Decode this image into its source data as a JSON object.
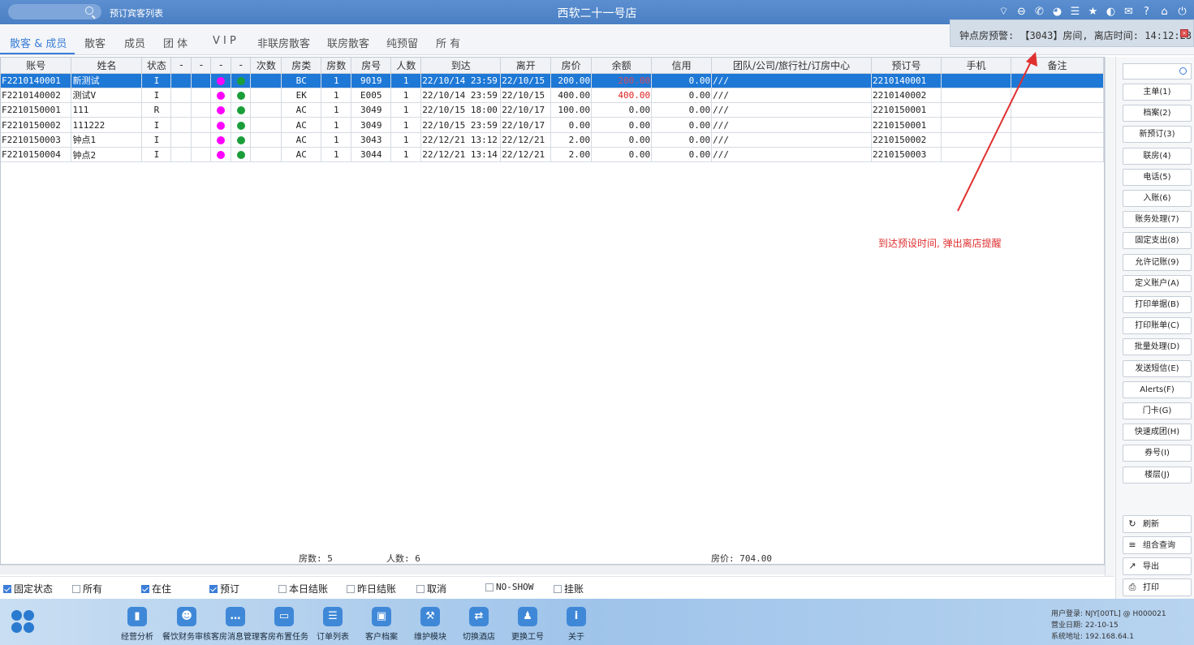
{
  "titlebar": {
    "booking_link": "预订宾客列表",
    "hotel_name": "西软二十一号店",
    "icons": [
      "wifi-icon",
      "minus-circle-icon",
      "phone-icon",
      "palette-icon",
      "menu-icon",
      "star-icon",
      "contrast-icon",
      "mail-icon",
      "help-icon",
      "home-icon",
      "power-icon"
    ]
  },
  "alert": {
    "text": "钟点房预警: 【3043】房间, 离店时间: 14:12:23"
  },
  "tabs": [
    {
      "label": "散客 & 成员",
      "active": true
    },
    {
      "label": "散客"
    },
    {
      "label": "成员"
    },
    {
      "label": "团 体"
    },
    {
      "label": "V I P"
    },
    {
      "label": "非联房散客"
    },
    {
      "label": "联房散客"
    },
    {
      "label": "纯预留"
    },
    {
      "label": "所 有"
    }
  ],
  "grid": {
    "columns": [
      "账号",
      "姓名",
      "状态",
      "-",
      "-",
      "-",
      "-",
      "次数",
      "房类",
      "房数",
      "房号",
      "人数",
      "到达",
      "离开",
      "房价",
      "余额",
      "信用",
      "团队/公司/旅行社/订房中心",
      "预订号",
      "手机",
      "备注"
    ],
    "rows": [
      {
        "account": "F2210140001",
        "name": "新测试",
        "status": "I",
        "c1": "",
        "c2": "",
        "dot1": "#ff00ff",
        "dot2": "#1a9e3a",
        "times": "",
        "room_type": "BC",
        "rooms": "1",
        "room_no": "9019",
        "persons": "1",
        "arrive": "22/10/14 23:59",
        "depart": "22/10/15",
        "rate": "200.00",
        "balance": "200.00",
        "balance_red": true,
        "credit": "0.00",
        "group": "///",
        "booking_no": "2210140001",
        "mobile": "",
        "remark": "",
        "selected": true
      },
      {
        "account": "F2210140002",
        "name": "测试V",
        "status": "I",
        "c1": "",
        "c2": "",
        "dot1": "#ff00ff",
        "dot2": "#1a9e3a",
        "times": "",
        "room_type": "EK",
        "rooms": "1",
        "room_no": "E005",
        "persons": "1",
        "arrive": "22/10/14 23:59",
        "depart": "22/10/15",
        "rate": "400.00",
        "balance": "400.00",
        "balance_red": true,
        "credit": "0.00",
        "group": "///",
        "booking_no": "2210140002",
        "mobile": "",
        "remark": ""
      },
      {
        "account": "F2210150001",
        "name": "111",
        "status": "R",
        "c1": "",
        "c2": "",
        "dot1": "#ff00ff",
        "dot2": "#1a9e3a",
        "times": "",
        "room_type": "AC",
        "rooms": "1",
        "room_no": "3049",
        "persons": "1",
        "arrive": "22/10/15 18:00",
        "depart": "22/10/17",
        "rate": "100.00",
        "balance": "0.00",
        "balance_red": false,
        "credit": "0.00",
        "group": "///",
        "booking_no": "2210150001",
        "mobile": "",
        "remark": ""
      },
      {
        "account": "F2210150002",
        "name": "111222",
        "status": "I",
        "c1": "",
        "c2": "",
        "dot1": "#ff00ff",
        "dot2": "#1a9e3a",
        "times": "",
        "room_type": "AC",
        "rooms": "1",
        "room_no": "3049",
        "persons": "1",
        "arrive": "22/10/15 23:59",
        "depart": "22/10/17",
        "rate": "0.00",
        "balance": "0.00",
        "balance_red": false,
        "credit": "0.00",
        "group": "///",
        "booking_no": "2210150001",
        "mobile": "",
        "remark": ""
      },
      {
        "account": "F2210150003",
        "name": "钟点1",
        "status": "I",
        "c1": "",
        "c2": "",
        "dot1": "#ff00ff",
        "dot2": "#1a9e3a",
        "times": "",
        "room_type": "AC",
        "rooms": "1",
        "room_no": "3043",
        "persons": "1",
        "arrive": "22/12/21 13:12",
        "depart": "22/12/21",
        "rate": "2.00",
        "balance": "0.00",
        "balance_red": false,
        "credit": "0.00",
        "group": "///",
        "booking_no": "2210150002",
        "mobile": "",
        "remark": ""
      },
      {
        "account": "F2210150004",
        "name": "钟点2",
        "status": "I",
        "c1": "",
        "c2": "",
        "dot1": "#ff00ff",
        "dot2": "#1a9e3a",
        "times": "",
        "room_type": "AC",
        "rooms": "1",
        "room_no": "3044",
        "persons": "1",
        "arrive": "22/12/21 13:14",
        "depart": "22/12/21",
        "rate": "2.00",
        "balance": "0.00",
        "balance_red": false,
        "credit": "0.00",
        "group": "///",
        "booking_no": "2210150003",
        "mobile": "",
        "remark": ""
      }
    ]
  },
  "totals": {
    "rooms": "房数: 5",
    "persons": "人数: 6",
    "rate": "房价: 704.00"
  },
  "right_panel": {
    "buttons": [
      "主单(1)",
      "档案(2)",
      "新预订(3)",
      "联房(4)",
      "电话(5)",
      "入账(6)",
      "账务处理(7)",
      "固定支出(8)",
      "允许记账(9)",
      "定义账户(A)",
      "打印单据(B)",
      "打印账单(C)",
      "批量处理(D)",
      "发送短信(E)",
      "Alerts(F)",
      "门卡(G)",
      "快速成团(H)",
      "券号(I)",
      "楼层(J)"
    ],
    "bottom_buttons": [
      {
        "icon": "refresh-icon",
        "label": "刷新"
      },
      {
        "icon": "list-icon",
        "label": "组合查询"
      },
      {
        "icon": "export-icon",
        "label": "导出"
      },
      {
        "icon": "printer-icon",
        "label": "打印"
      }
    ]
  },
  "filters": [
    {
      "label": "固定状态",
      "checked": true
    },
    {
      "label": "所有",
      "checked": false
    },
    {
      "label": "在住",
      "checked": true
    },
    {
      "label": "预订",
      "checked": true
    },
    {
      "label": "本日结账",
      "checked": false
    },
    {
      "label": "昨日结账",
      "checked": false
    },
    {
      "label": "取消",
      "checked": false
    },
    {
      "label": "NO-SHOW",
      "checked": false
    },
    {
      "label": "挂账",
      "checked": false
    }
  ],
  "footer": {
    "buttons": [
      {
        "icon": "bar-chart-icon",
        "label": "经营分析"
      },
      {
        "icon": "user-icon",
        "label": "餐饮财务审核"
      },
      {
        "icon": "chat-icon",
        "label": "客房消息管理"
      },
      {
        "icon": "bed-icon",
        "label": "客房布置任务"
      },
      {
        "icon": "list-icon",
        "label": "订单列表"
      },
      {
        "icon": "id-card-icon",
        "label": "客户档案"
      },
      {
        "icon": "wrench-icon",
        "label": "维护模块"
      },
      {
        "icon": "switch-icon",
        "label": "切换酒店"
      },
      {
        "icon": "user-switch-icon",
        "label": "更换工号"
      },
      {
        "icon": "info-icon",
        "label": "关于"
      }
    ],
    "sysinfo": {
      "login": "用户登录: NJY[00TL] @ H000021",
      "business_date": "营业日期: 22-10-15",
      "address": "系统地址: 192.168.64.1"
    }
  },
  "annotation": {
    "text": "到达预设时间, 弹出离店提醒",
    "color": "#e03030"
  }
}
